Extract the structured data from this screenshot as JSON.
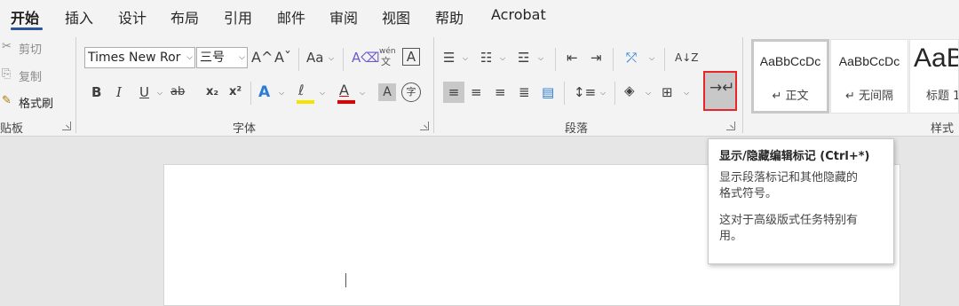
{
  "tabs": [
    "开始",
    "插入",
    "设计",
    "布局",
    "引用",
    "邮件",
    "审阅",
    "视图",
    "帮助",
    "Acrobat"
  ],
  "clipboard": {
    "cut": "剪切",
    "copy": "复制",
    "format_painter": "格式刷",
    "label": "贴板"
  },
  "font": {
    "name": "Times New Ror",
    "size": "三号",
    "grow_icon": "A^",
    "shrink_icon": "Aˇ",
    "case": "Aa",
    "label": "字体",
    "bold": "B",
    "italic": "I",
    "underline": "U",
    "strike": "ab",
    "subscript": "x₂",
    "superscript": "x²",
    "phonetic_top": "wén",
    "phonetic_bottom": "文",
    "char_border": "A",
    "text_effects": "A",
    "highlight": "ℓ",
    "font_color": "A",
    "char_shading": "A",
    "enclose": "字",
    "colors": {
      "highlight": "#f5e400",
      "font_color": "#e00000"
    }
  },
  "paragraph": {
    "label": "段落",
    "sort": "A↓Z"
  },
  "styles": {
    "label": "样式",
    "items": [
      {
        "sample": "AaBbCcDc",
        "name": "↵ 正文"
      },
      {
        "sample": "AaBbCcDc",
        "name": "↵ 无间隔"
      },
      {
        "sample": "AaB",
        "name": "标题 1"
      }
    ]
  },
  "tooltip": {
    "title": "显示/隐藏编辑标记 (Ctrl+*)",
    "line1": "显示段落标记和其他隐藏的",
    "line2": "格式符号。",
    "line3": "这对于高级版式任务特别有",
    "line4": "用。"
  }
}
